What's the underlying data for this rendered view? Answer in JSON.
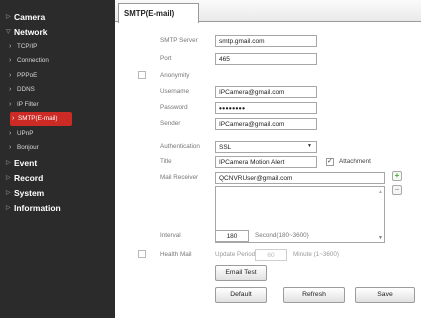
{
  "sidebar": {
    "sections": [
      {
        "label": "Camera"
      },
      {
        "label": "Network"
      },
      {
        "label": "Event"
      },
      {
        "label": "Record"
      },
      {
        "label": "System"
      },
      {
        "label": "Information"
      }
    ],
    "network_items": [
      "TCP/IP",
      "Connection",
      "PPPoE",
      "DDNS",
      "IP Filter",
      "SMTP(E-mail)",
      "UPnP",
      "Bonjour"
    ],
    "active_item": "SMTP(E-mail)"
  },
  "tab": {
    "label": "SMTP(E-mail)"
  },
  "form": {
    "smtp_server": {
      "label": "SMTP Server",
      "value": "smtp.gmail.com"
    },
    "port": {
      "label": "Port",
      "value": "465"
    },
    "anonymity": {
      "label": "Anonymity",
      "checked": false
    },
    "username": {
      "label": "Username",
      "value": "IPCamera@gmail.com"
    },
    "password": {
      "label": "Password",
      "value": "••••••••"
    },
    "sender": {
      "label": "Sender",
      "value": "IPCamera@gmail.com"
    },
    "authentication": {
      "label": "Authentication",
      "value": "SSL"
    },
    "title": {
      "label": "Title",
      "value": "IPCamera Motion Alert"
    },
    "attachment": {
      "label": "Attachment",
      "checked": true
    },
    "mail_receiver": {
      "label": "Mail Receiver",
      "value": "QCNVRUser@gmail.com"
    },
    "interval": {
      "label": "Interval",
      "value": "180",
      "unit": "Second(180~3600)"
    },
    "health_mail": {
      "label": "Health Mail",
      "checked": false,
      "update_period_label": "Update Period",
      "update_period_value": "60",
      "minute_label": "Minute (1~3600)"
    }
  },
  "buttons": {
    "email_test": "Email Test",
    "default": "Default",
    "refresh": "Refresh",
    "save": "Save"
  },
  "icons": {
    "add": "+",
    "remove": "−"
  }
}
